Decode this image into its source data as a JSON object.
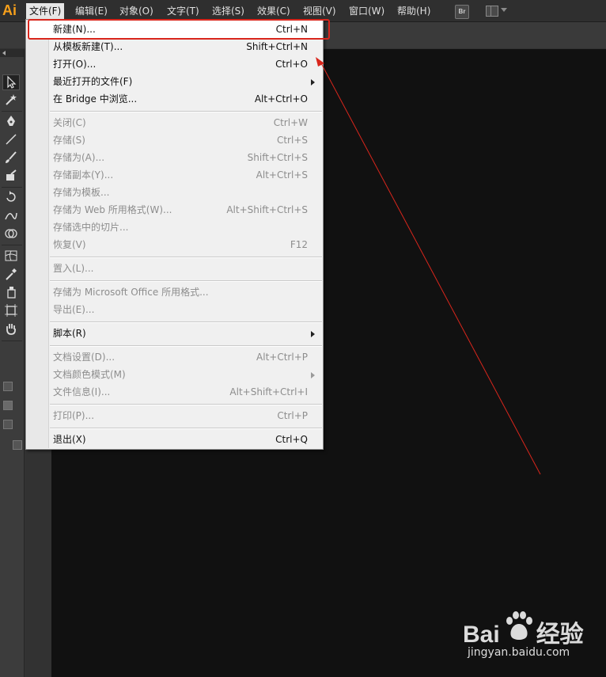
{
  "app": {
    "logo": "Ai",
    "bridge_badge": "Br"
  },
  "menubar": {
    "items": [
      {
        "label": "文件(F)"
      },
      {
        "label": "编辑(E)"
      },
      {
        "label": "对象(O)"
      },
      {
        "label": "文字(T)"
      },
      {
        "label": "选择(S)"
      },
      {
        "label": "效果(C)"
      },
      {
        "label": "视图(V)"
      },
      {
        "label": "窗口(W)"
      },
      {
        "label": "帮助(H)"
      }
    ]
  },
  "file_menu": {
    "items": [
      {
        "label": "新建(N)...",
        "shortcut": "Ctrl+N",
        "enabled": true
      },
      {
        "label": "从模板新建(T)...",
        "shortcut": "Shift+Ctrl+N",
        "enabled": true
      },
      {
        "label": "打开(O)...",
        "shortcut": "Ctrl+O",
        "enabled": true
      },
      {
        "label": "最近打开的文件(F)",
        "shortcut": "",
        "enabled": true,
        "submenu": true
      },
      {
        "label": "在 Bridge 中浏览...",
        "shortcut": "Alt+Ctrl+O",
        "enabled": true
      },
      {
        "label": "关闭(C)",
        "shortcut": "Ctrl+W",
        "enabled": false
      },
      {
        "label": "存储(S)",
        "shortcut": "Ctrl+S",
        "enabled": false
      },
      {
        "label": "存储为(A)...",
        "shortcut": "Shift+Ctrl+S",
        "enabled": false
      },
      {
        "label": "存储副本(Y)...",
        "shortcut": "Alt+Ctrl+S",
        "enabled": false
      },
      {
        "label": "存储为模板...",
        "shortcut": "",
        "enabled": false
      },
      {
        "label": "存储为 Web 所用格式(W)...",
        "shortcut": "Alt+Shift+Ctrl+S",
        "enabled": false
      },
      {
        "label": "存储选中的切片...",
        "shortcut": "",
        "enabled": false
      },
      {
        "label": "恢复(V)",
        "shortcut": "F12",
        "enabled": false
      },
      {
        "label": "置入(L)...",
        "shortcut": "",
        "enabled": false
      },
      {
        "label": "存储为 Microsoft Office 所用格式...",
        "shortcut": "",
        "enabled": false
      },
      {
        "label": "导出(E)...",
        "shortcut": "",
        "enabled": false
      },
      {
        "label": "脚本(R)",
        "shortcut": "",
        "enabled": true,
        "submenu": true
      },
      {
        "label": "文档设置(D)...",
        "shortcut": "Alt+Ctrl+P",
        "enabled": false
      },
      {
        "label": "文档颜色模式(M)",
        "shortcut": "",
        "enabled": false,
        "submenu": true
      },
      {
        "label": "文件信息(I)...",
        "shortcut": "Alt+Shift+Ctrl+I",
        "enabled": false
      },
      {
        "label": "打印(P)...",
        "shortcut": "Ctrl+P",
        "enabled": false
      },
      {
        "label": "退出(X)",
        "shortcut": "Ctrl+Q",
        "enabled": true
      }
    ]
  },
  "watermark": {
    "brand": "Bai",
    "brand2": "经验",
    "url": "jingyan.baidu.com"
  },
  "colors": {
    "highlight": "#d9261c",
    "arrow": "#d9261c",
    "logo": "#f7a01b"
  }
}
